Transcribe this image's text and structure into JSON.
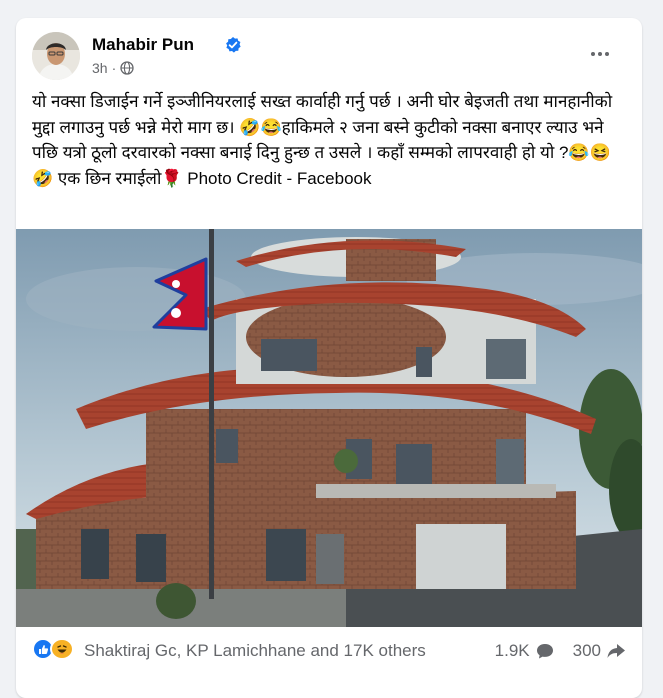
{
  "post": {
    "author": "Mahabir Pun",
    "time": "3h",
    "separator": "·",
    "text": "यो नक्सा डिजाईन गर्ने इञ्जीनियरलाई सख्त कार्वाही गर्नु पर्छ । अनी घोर बेइजती तथा मानहानीको मुद्दा लगाउनु पर्छ भन्ने मेरो माग छ। 🤣😂हाकिमले २ जना बस्ने कुटीको नक्सा बनाएर ल्याउ भने पछि यत्रो ठूलो दरवारको नक्सा बनाई दिनु हुन्छ त उसले । कहाँ सम्मको लापरवाही हो यो ?😂😆🤣 एक छिन रमाईलो🌹 Photo Credit - Facebook"
  },
  "footer": {
    "reactors": "Shaktiraj Gc, KP Lamichhane and 17K others",
    "comments": "1.9K",
    "shares": "300"
  },
  "icons": {
    "verified": "verified-badge-icon",
    "audience": "globe-icon",
    "menu": "more-options-icon",
    "like": "like-reaction-icon",
    "haha": "haha-reaction-icon",
    "comment": "comment-bubble-icon",
    "share": "share-arrow-icon"
  },
  "colors": {
    "brand_blue": "#1877f2",
    "secondary_text": "#65676b",
    "background": "#f0f2f5"
  }
}
